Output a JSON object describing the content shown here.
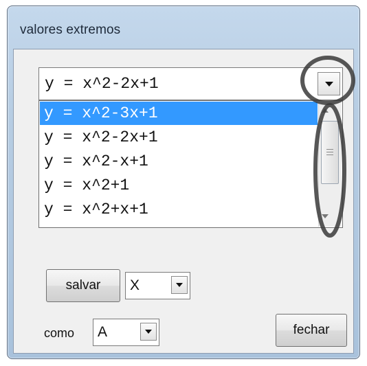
{
  "window": {
    "title": "valores extremos"
  },
  "combo": {
    "value": "y = x^2-2x+1"
  },
  "list": {
    "items": [
      "y = x^2-3x+1",
      "y = x^2-2x+1",
      "y = x^2-x+1",
      "y = x^2+1",
      "y = x^2+x+1"
    ],
    "selected_index": 0
  },
  "buttons": {
    "save": "salvar",
    "close": "fechar"
  },
  "variable_combo": {
    "value": "X"
  },
  "as_label": "como",
  "target_combo": {
    "value": "A"
  },
  "colors": {
    "selection": "#3399ff",
    "annotation": "#3a3a3a"
  },
  "icons": [
    "dropdown-arrow-icon",
    "scroll-up-icon",
    "scroll-down-icon",
    "scrollbar-grip-icon"
  ]
}
